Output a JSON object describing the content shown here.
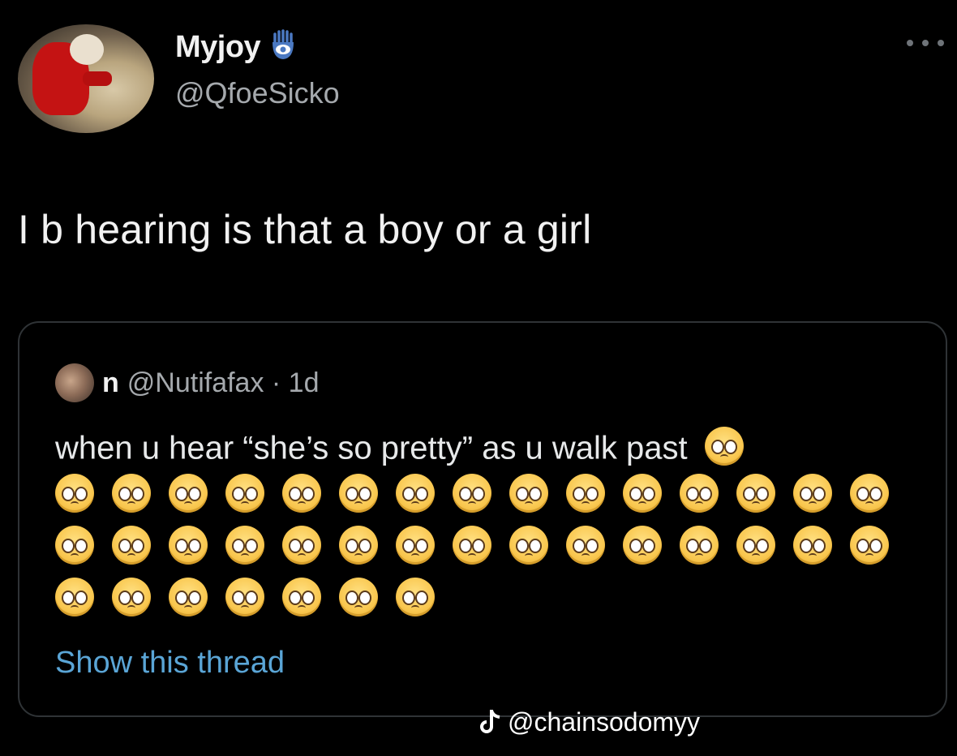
{
  "author": {
    "name": "Myjoy",
    "handle": "@QfoeSicko",
    "badge_icon": "hamsa-eye-icon"
  },
  "more_menu": {
    "icon": "more-dots-icon"
  },
  "tweet": {
    "text": "I b hearing is that a boy or a girl"
  },
  "quoted_tweet": {
    "name": "n",
    "handle_time": "@Nutifafax · 1d",
    "text": "when u hear “she’s so pretty” as u walk past",
    "emoji": "pleading-face-icon",
    "emoji_rows": [
      15,
      15,
      7
    ],
    "show_thread": "Show this thread"
  },
  "watermark": {
    "icon": "tiktok-icon",
    "text": "@chainsodomyy"
  },
  "colors": {
    "background": "#000000",
    "link": "#5aa5d6",
    "secondary_text": "#a5a9ad",
    "border": "#2f3336"
  }
}
